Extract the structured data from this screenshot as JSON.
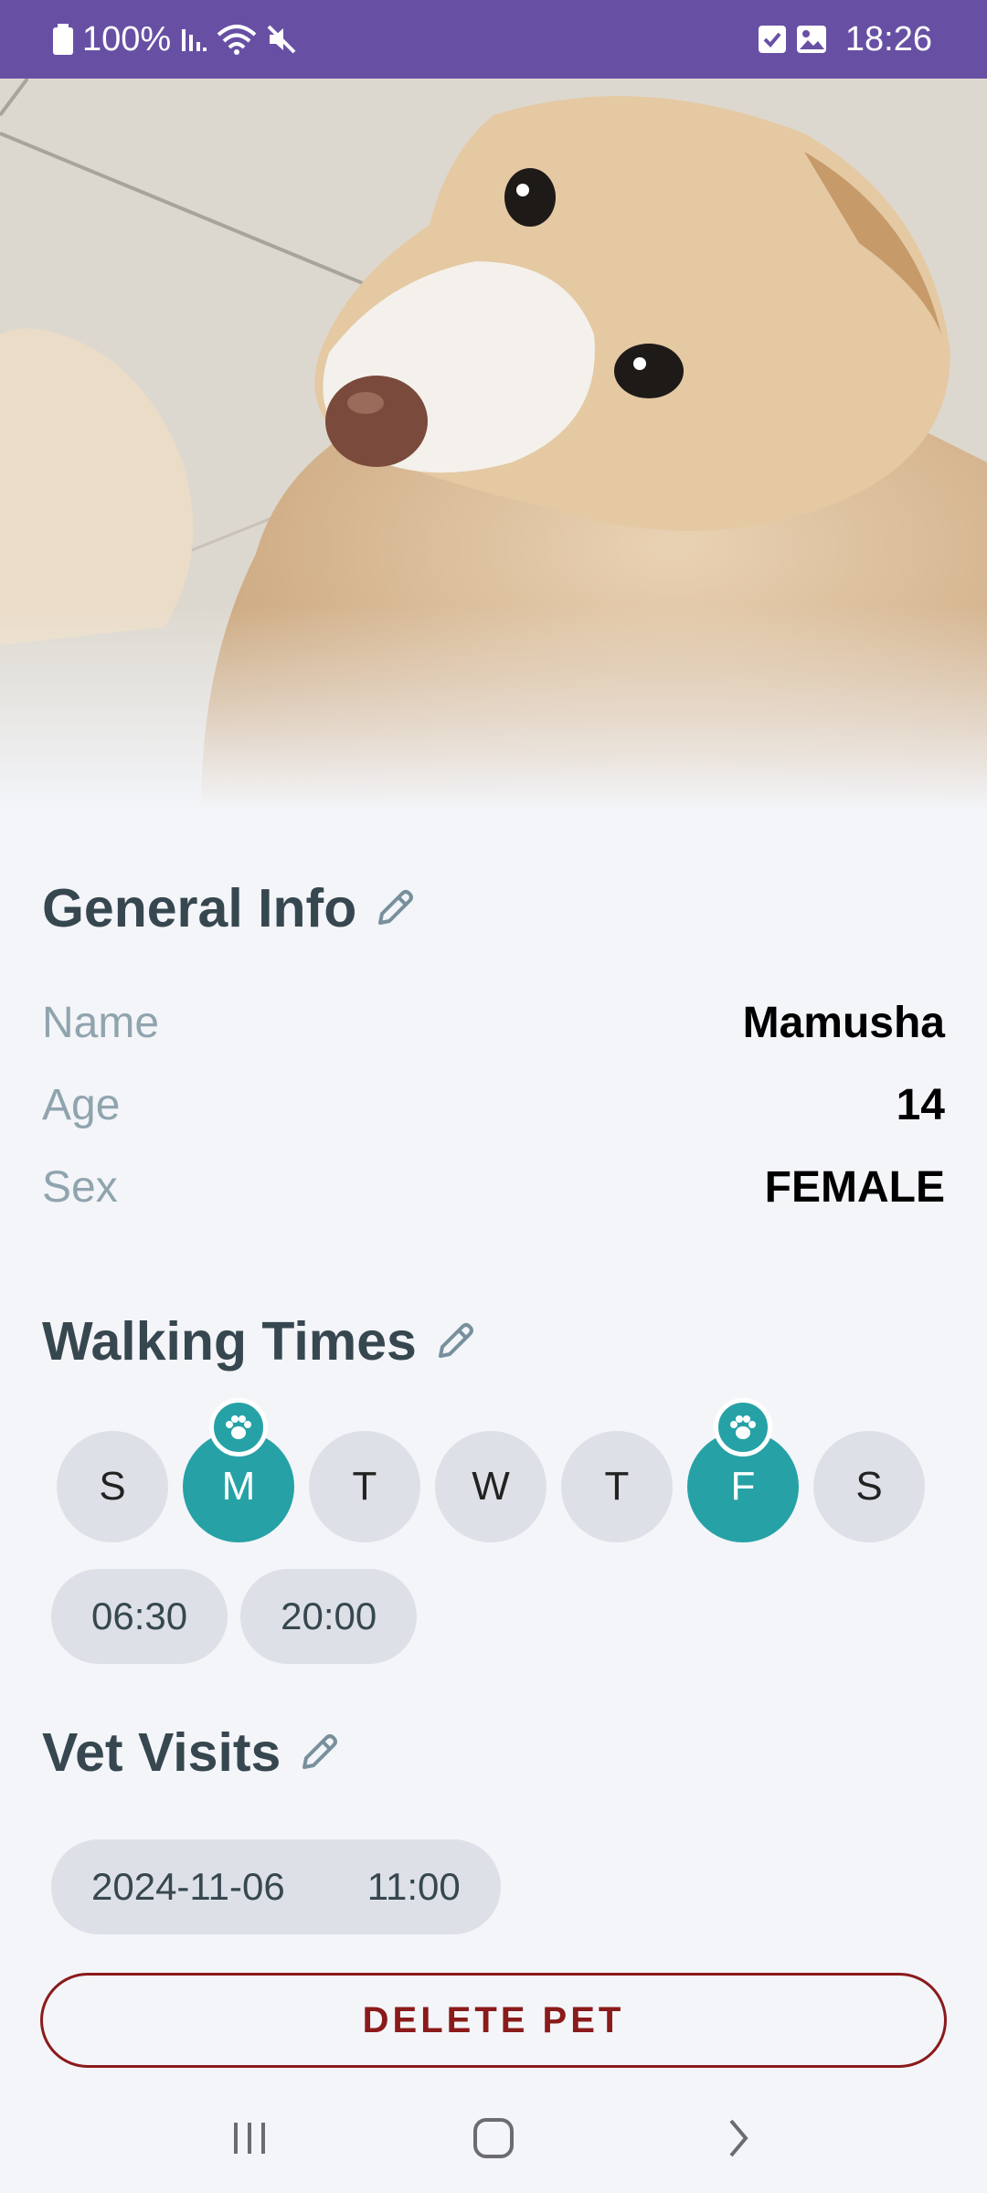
{
  "status_bar": {
    "battery": "100%",
    "time": "18:26",
    "icons": [
      "battery-icon",
      "signal-icon",
      "wifi-icon",
      "mute-icon",
      "checkbox-icon",
      "image-icon"
    ]
  },
  "hero": {
    "icon": "pet-photo"
  },
  "general_info": {
    "title": "General Info",
    "rows": [
      {
        "label": "Name",
        "value": "Mamusha"
      },
      {
        "label": "Age",
        "value": "14"
      },
      {
        "label": "Sex",
        "value": "FEMALE"
      }
    ]
  },
  "walking_times": {
    "title": "Walking Times",
    "days": [
      {
        "letter": "S",
        "active": false
      },
      {
        "letter": "M",
        "active": true
      },
      {
        "letter": "T",
        "active": false
      },
      {
        "letter": "W",
        "active": false
      },
      {
        "letter": "T",
        "active": false
      },
      {
        "letter": "F",
        "active": true
      },
      {
        "letter": "S",
        "active": false
      }
    ],
    "times": [
      "06:30",
      "20:00"
    ]
  },
  "vet_visits": {
    "title": "Vet Visits",
    "visits": [
      {
        "date": "2024-11-06",
        "time": "11:00"
      }
    ]
  },
  "delete_label": "DELETE PET",
  "colors": {
    "accent": "#26a2a6",
    "status_bar": "#6750a4",
    "danger": "#8b1a1a",
    "title": "#37474f",
    "label": "#90a4ae"
  }
}
